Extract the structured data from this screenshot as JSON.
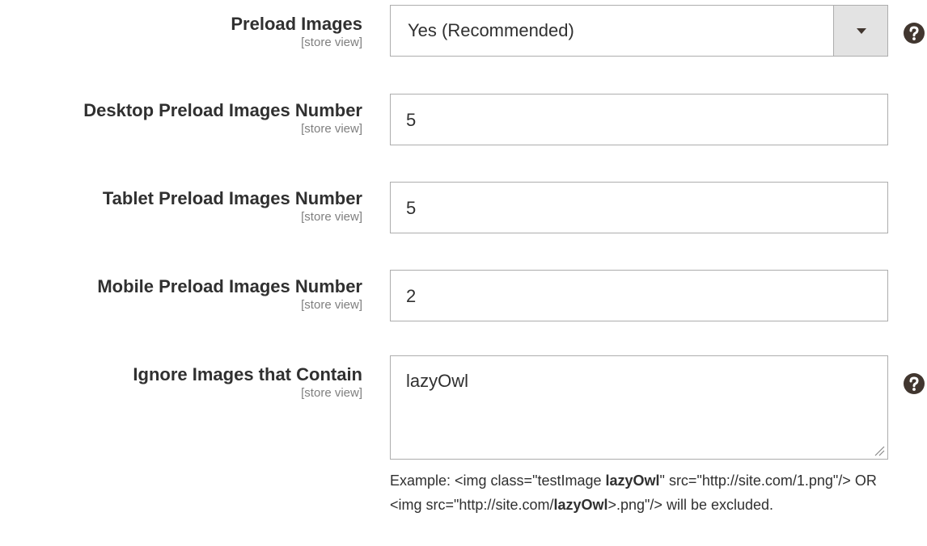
{
  "fields": {
    "preload_images": {
      "label": "Preload Images",
      "scope": "[store view]",
      "value": "Yes (Recommended)"
    },
    "desktop_number": {
      "label": "Desktop Preload Images Number",
      "scope": "[store view]",
      "value": "5"
    },
    "tablet_number": {
      "label": "Tablet Preload Images Number",
      "scope": "[store view]",
      "value": "5"
    },
    "mobile_number": {
      "label": "Mobile Preload Images Number",
      "scope": "[store view]",
      "value": "2"
    },
    "ignore_images": {
      "label": "Ignore Images that Contain",
      "scope": "[store view]",
      "value": "lazyOwl"
    }
  },
  "note": {
    "p1": "Example: <img class=\"testImage ",
    "b1": "lazyOwl",
    "p2": "\" src=\"http://site.com/1.png\"/> OR <img src=\"http://site.com/",
    "b2": "lazyOwl",
    "p3": ">.png\"/> will be excluded."
  },
  "icons": {
    "help": "help-circle-icon",
    "dropdown": "dropdown-arrow-icon",
    "resize": "resize-grip-icon"
  }
}
